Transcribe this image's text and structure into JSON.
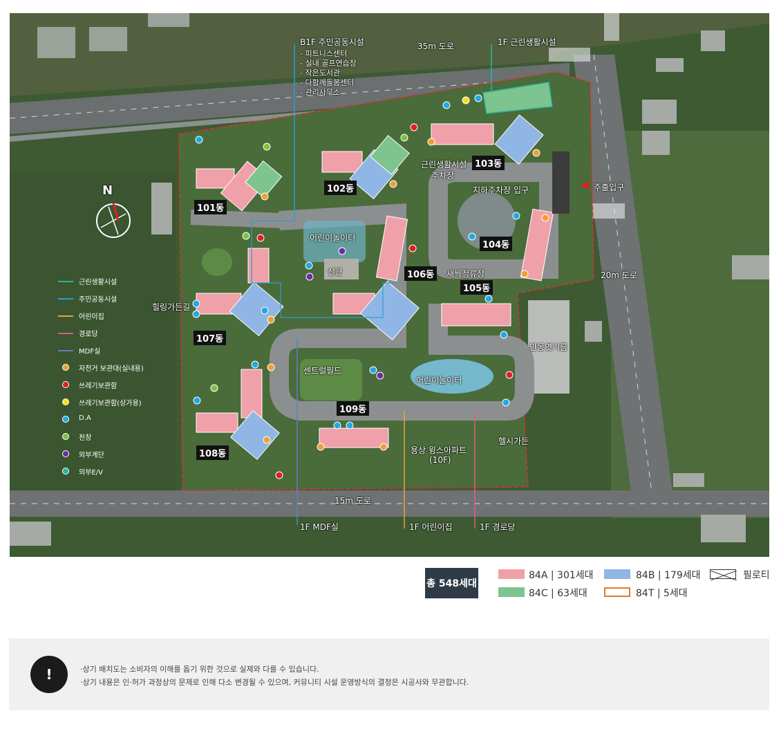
{
  "map": {
    "roads": {
      "top": "35m 도로",
      "right": "20m 도로",
      "bottom": "15m 도로"
    },
    "callouts": {
      "b1f_title": "B1F 주민공동시설",
      "b1f_items": [
        "- 피트니스센터",
        "- 실내 골프연습장",
        "- 작은도서관",
        "- 다함께돌봄센터",
        "- 관리사무소"
      ],
      "f1_retail": "1F 근린생활시설",
      "f1_mdf": "1F MDF실",
      "f1_daycare": "1F 어린이집",
      "f1_senior": "1F 경로당"
    },
    "places": {
      "playground_north": "어린이놀이터",
      "pavilion": "선큰",
      "retail_parking_1": "근린생활시설",
      "retail_parking_2": "주차장",
      "underground_entrance": "지하주차장 입구",
      "entry_exit": "주출입구",
      "saessak_stop": "새싹정류장",
      "healing_garden": "힐링가든길",
      "central_field": "센트럴필드",
      "playground_south": "어린이놀이터",
      "neighbor_apt_1": "용상 윙스아파트",
      "neighbor_apt_2": "(10F)",
      "neighbor_field": "안동엿기름",
      "health_garden": "헬시가든"
    },
    "buildings": [
      "101동",
      "102동",
      "103동",
      "104동",
      "105동",
      "106동",
      "107동",
      "108동",
      "109동"
    ],
    "north": "N",
    "legend": [
      {
        "label": "근린생활시설",
        "kind": "line",
        "color": "#26b6a1"
      },
      {
        "label": "주민공동시설",
        "kind": "line",
        "color": "#2a9ed8"
      },
      {
        "label": "어린이집",
        "kind": "line",
        "color": "#e8a33a"
      },
      {
        "label": "경로당",
        "kind": "line",
        "color": "#e05a8a"
      },
      {
        "label": "MDF실",
        "kind": "line",
        "color": "#5d7fc7"
      },
      {
        "label": "자전거 보관대(실내용)",
        "kind": "dot",
        "color": "#f0a030"
      },
      {
        "label": "쓰레기보관함",
        "kind": "dot",
        "color": "#e02020"
      },
      {
        "label": "쓰레기보관함(상가용)",
        "kind": "dot",
        "color": "#f2e020"
      },
      {
        "label": "D.A",
        "kind": "dot",
        "color": "#23a9e1"
      },
      {
        "label": "천창",
        "kind": "dot",
        "color": "#7cc242"
      },
      {
        "label": "외부계단",
        "kind": "dot",
        "color": "#6b2fa0"
      },
      {
        "label": "외부E/V",
        "kind": "dot",
        "color": "#25b8a0"
      }
    ]
  },
  "units": {
    "total": "총 548세대",
    "types": [
      {
        "name": "84A",
        "count": "301세대",
        "color": "#f0a0a8",
        "style": "fill"
      },
      {
        "name": "84B",
        "count": "179세대",
        "color": "#8fb6e4",
        "style": "fill"
      },
      {
        "name": "84C",
        "count": "63세대",
        "color": "#7dc48f",
        "style": "fill"
      },
      {
        "name": "84T",
        "count": "5세대",
        "color": "#e07a2a",
        "style": "outline"
      }
    ],
    "piloti": "필로티"
  },
  "notice": {
    "icon": "!",
    "lines": [
      "·상기 배치도는 소비자의 이해를 돕기 위한 것으로 실제와 다를 수 있습니다.",
      "·상기 내용은 인·허가 과정상의 문제로 인해 다소 변경될 수 있으며, 커뮤니티 시설 운영방식의 결정은 시공사와 무관합니다."
    ]
  }
}
